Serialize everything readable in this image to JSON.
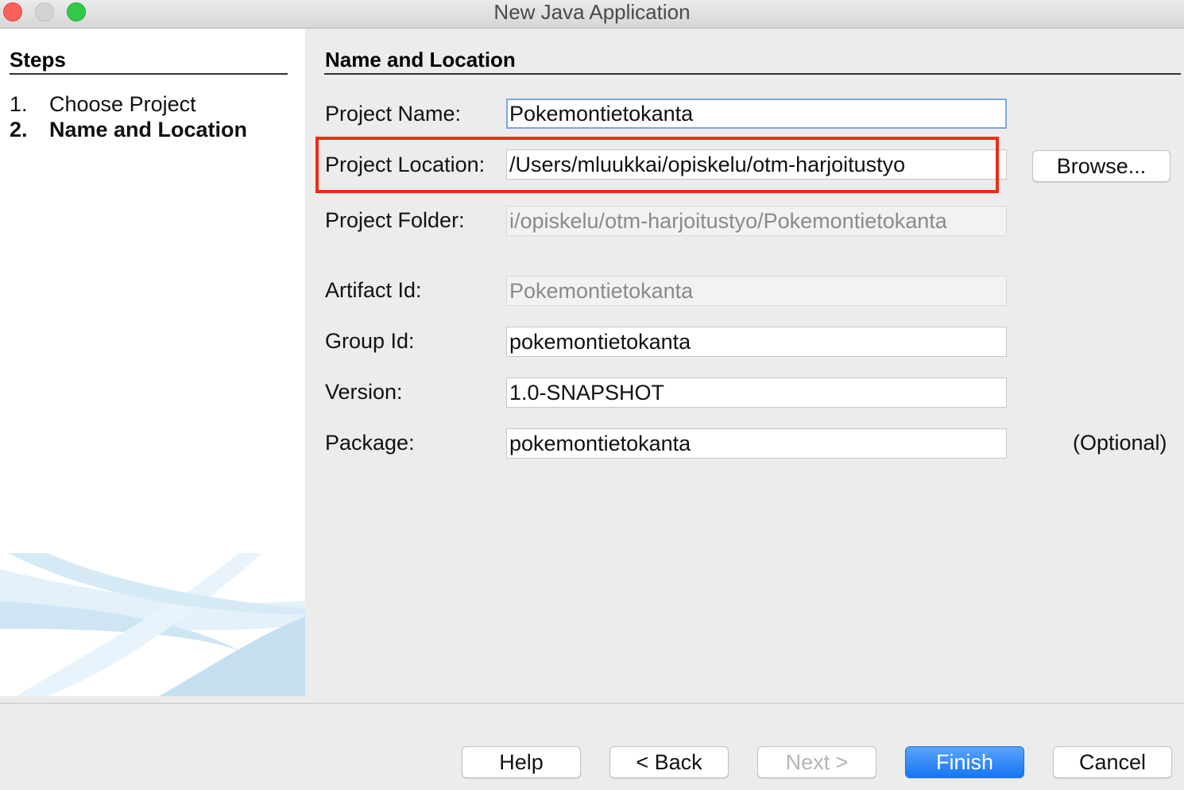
{
  "window": {
    "title": "New Java Application"
  },
  "steps": {
    "title": "Steps",
    "items": [
      {
        "num": "1.",
        "label": "Choose Project"
      },
      {
        "num": "2.",
        "label": "Name and Location"
      }
    ]
  },
  "main": {
    "title": "Name and Location",
    "fields": {
      "project_name": {
        "label": "Project Name:",
        "value": "Pokemontietokanta"
      },
      "project_location": {
        "label": "Project Location:",
        "value": "/Users/mluukkai/opiskelu/otm-harjoitustyo"
      },
      "project_folder": {
        "label": "Project Folder:",
        "value": "i/opiskelu/otm-harjoitustyo/Pokemontietokanta"
      },
      "artifact_id": {
        "label": "Artifact Id:",
        "value": "Pokemontietokanta"
      },
      "group_id": {
        "label": "Group Id:",
        "value": "pokemontietokanta"
      },
      "version": {
        "label": "Version:",
        "value": "1.0-SNAPSHOT"
      },
      "package": {
        "label": "Package:",
        "value": "pokemontietokanta"
      }
    },
    "browse_label": "Browse...",
    "optional_label": "(Optional)"
  },
  "buttons": {
    "help": "Help",
    "back": "< Back",
    "next": "Next >",
    "finish": "Finish",
    "cancel": "Cancel"
  },
  "colors": {
    "highlight": "#ee2b17",
    "primary": "#1676f3",
    "focus_ring": "#7aa7e3"
  },
  "icons": [
    "close-icon",
    "minimize-icon",
    "maximize-icon"
  ]
}
